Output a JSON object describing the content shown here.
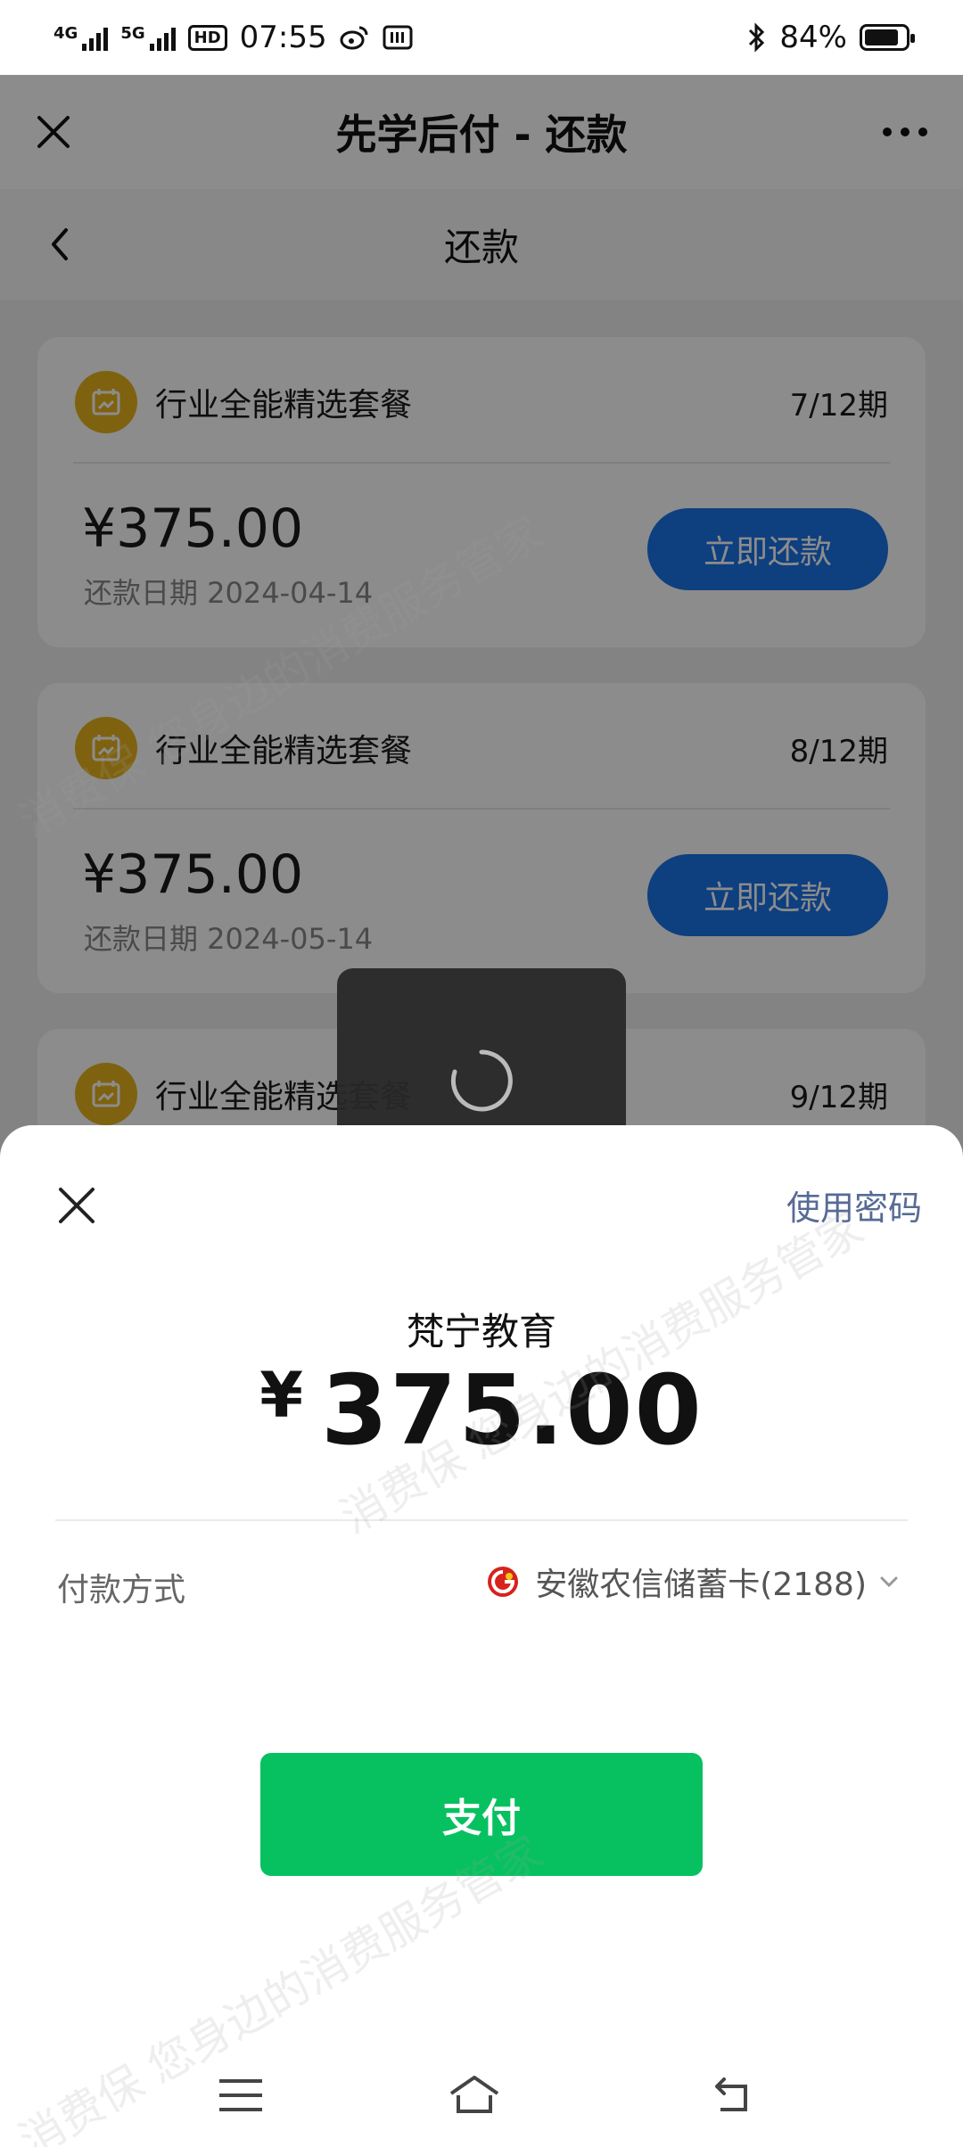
{
  "status_bar": {
    "network_1": "4G",
    "network_2": "5G",
    "hd_badge": "HD",
    "time": "07:55",
    "battery": "84%"
  },
  "nav": {
    "title": "先学后付 - 还款"
  },
  "subnav": {
    "title": "还款"
  },
  "cards": [
    {
      "product": "行业全能精选套餐",
      "period": "7/12期",
      "amount": "¥375.00",
      "due": "还款日期 2024-04-14",
      "button": "立即还款"
    },
    {
      "product": "行业全能精选套餐",
      "period": "8/12期",
      "amount": "¥375.00",
      "due": "还款日期 2024-05-14",
      "button": "立即还款"
    },
    {
      "product": "行业全能精选套餐",
      "period": "9/12期"
    }
  ],
  "payment_sheet": {
    "use_password": "使用密码",
    "merchant": "梵宁教育",
    "currency": "¥",
    "amount": "375.00",
    "method_label": "付款方式",
    "method_value": "安徽农信储蓄卡(2188)",
    "pay_button": "支付"
  },
  "watermark": "消费保 您身边的消费服务管家",
  "colors": {
    "pay_green": "#07c160",
    "repay_blue": "#1a73e8",
    "link": "#576b95",
    "product_icon": "#e8b21c"
  }
}
